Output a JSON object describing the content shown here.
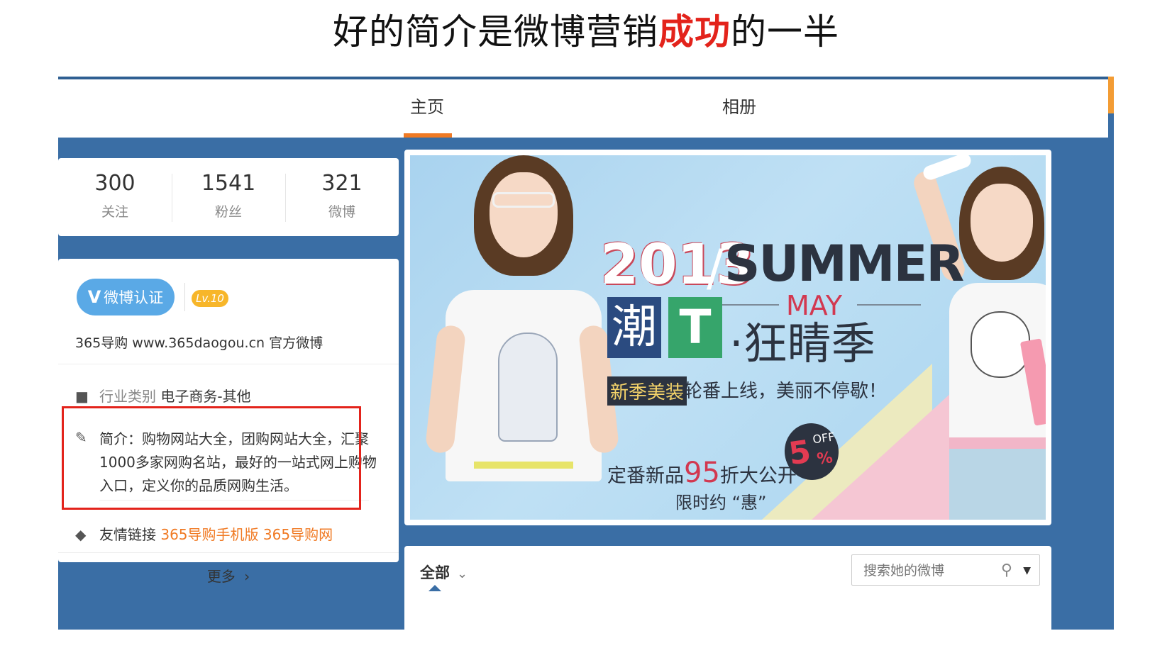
{
  "slide": {
    "title_before": "好的简介是微博营销",
    "title_highlight": "成功",
    "title_after": "的一半"
  },
  "nav": {
    "tabs": [
      {
        "label": "主页",
        "active": true
      },
      {
        "label": "相册",
        "active": false
      }
    ]
  },
  "stats": [
    {
      "num": "300",
      "label": "关注"
    },
    {
      "num": "1541",
      "label": "粉丝"
    },
    {
      "num": "321",
      "label": "微博"
    }
  ],
  "profile": {
    "verify_label": "微博认证",
    "verify_icon": "V",
    "level": "Lv.10",
    "handle": "365导购 www.365daogou.cn 官方微博",
    "industry_label": "行业类别",
    "industry_value": "电子商务-其他",
    "intro_label": "简介：",
    "intro_text": "购物网站大全，团购网站大全，汇聚1000多家网购名站，最好的一站式网上购物入口，定义你的品质网购生活。",
    "links_label": "友情链接",
    "links": [
      "365导购手机版",
      "365导购网"
    ],
    "more_label": "更多",
    "more_icon": "›"
  },
  "banner": {
    "year": "2013",
    "slash": "/",
    "summer": "SUMMER",
    "may": "MAY",
    "chao": "潮",
    "t": "T",
    "kuang": "·狂睛季",
    "xinji": "新季美装",
    "lunfan": "轮番上线，美丽不停歇！",
    "dingfan_pre": "定番新品",
    "dingfan_num": "95",
    "dingfan_post": "折大公开",
    "xianshi": "限时约 “惠”",
    "badge_num": "5",
    "badge_off": "OFF",
    "badge_pct": "%"
  },
  "feed": {
    "all_label": "全部",
    "all_chevron": "⌄",
    "search_placeholder": "搜索她的微博",
    "search_icon": "🔍",
    "search_dropdown": "▼"
  },
  "colors": {
    "frame_blue": "#3a6ea5",
    "accent_orange": "#f07a24",
    "highlight_red": "#e3231b",
    "verify_blue": "#5aa9e6",
    "level_yellow": "#f7b62a"
  }
}
